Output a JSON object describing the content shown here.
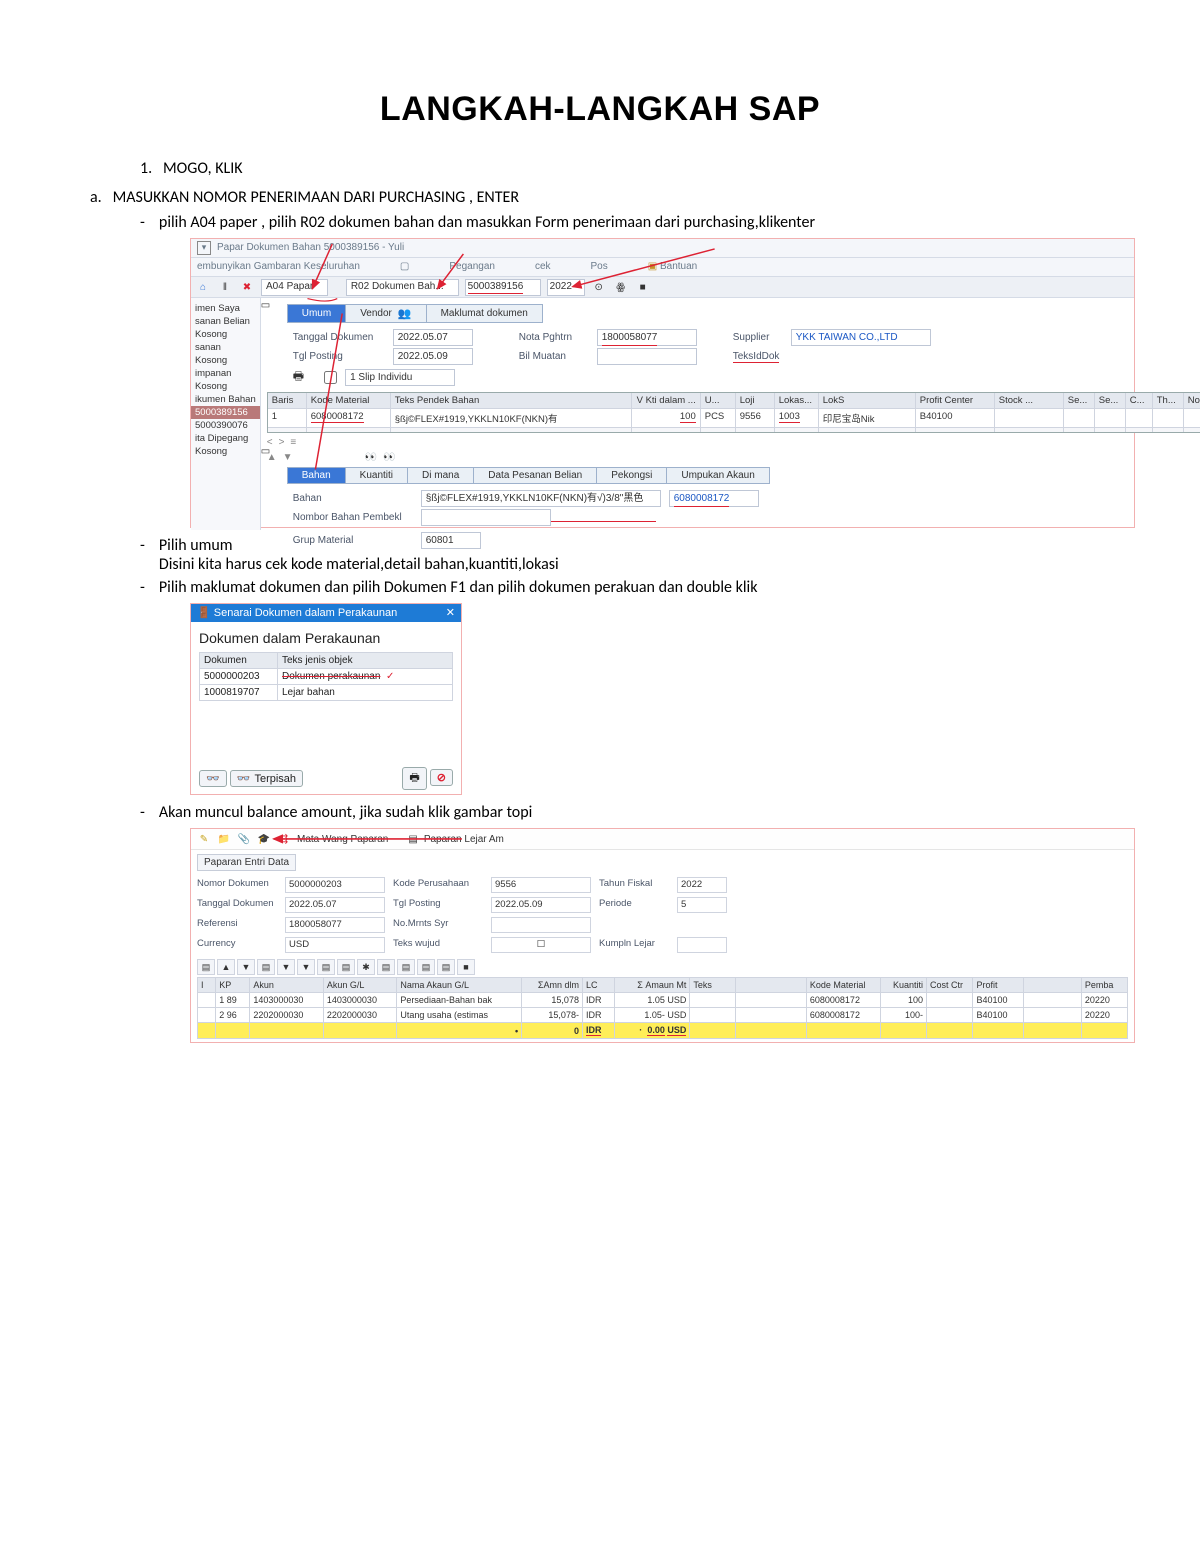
{
  "title": "LANGKAH-LANGKAH SAP",
  "step1": "MOGO, KLIK",
  "step_a": "MASUKKAN NOMOR PENERIMAAN DARI PURCHASING , ENTER",
  "bullet1": "pilih A04 paper , pilih R02 dokumen bahan  dan masukkan Form penerimaan dari purchasing,klikenter",
  "bullet2a": "Pilih umum",
  "bullet2b": "Disini kita harus cek kode material,detail bahan,kuantiti,lokasi",
  "bullet3": "Pilih maklumat dokumen dan pilih Dokumen F1 dan pilih dokumen perakuan dan double klik",
  "bullet4": "Akan muncul balance amount, jika sudah klik gambar topi",
  "sap1": {
    "title": "Papar Dokumen Bahan 5000389156 - Yuli",
    "subtitle": "embunyikan Gambaran Keseluruhan",
    "menu": {
      "pegangan": "Pegangan",
      "cek": "cek",
      "pos": "Pos",
      "bantuan": "Bantuan"
    },
    "a04": "A04 Papar",
    "r02": "R02 Dokumen Bah...",
    "doc": "5000389156",
    "year": "2022",
    "sidebar": {
      "i0": "imen Saya",
      "i1": "sanan Belian",
      "i2": "Kosong",
      "i3": "sanan",
      "i4": "Kosong",
      "i5": "impanan",
      "i6": "Kosong",
      "i7": "ikumen Bahan",
      "i8": "5000389156",
      "i9": "5000390076",
      "i10": "ita Dipegang",
      "i11": "Kosong"
    },
    "tabs": {
      "umum": "Umum",
      "vendor": "Vendor",
      "maklumat": "Maklumat dokumen"
    },
    "fields": {
      "tgl_dok_l": "Tanggal Dokumen",
      "tgl_dok_v": "2022.05.07",
      "tgl_post_l": "Tgl Posting",
      "tgl_post_v": "2022.05.09",
      "nota_l": "Nota Pghtrn",
      "nota_v": "1800058077",
      "bil_l": "Bil Muatan",
      "supp_l": "Supplier",
      "supp_v": "YKK TAIWAN CO.,LTD",
      "teks_l": "TeksIdDok",
      "slip": "1 Slip Individu"
    },
    "grid": {
      "h_baris": "Baris",
      "h_mat": "Kode Material",
      "h_desc": "Teks Pendek Bahan",
      "h_kti": "V Kti dalam ...",
      "h_u": "U...",
      "h_loji": "Loji",
      "h_lokas": "Lokas...",
      "h_loks": "LokS",
      "h_pc": "Profit Center",
      "h_stock": "Stock ...",
      "h_se": "Se...",
      "h_se2": "Se...",
      "h_c": "C...",
      "h_th": "Th...",
      "h_no": "No",
      "r1_baris": "1",
      "r1_mat": "6080008172",
      "r1_desc": "§ßj©FLEX#1919,YKKLN10KF(NKN)有",
      "r1_kti": "100",
      "r1_u": "PCS",
      "r1_loji": "9556",
      "r1_lokas": "1003",
      "r1_loks": "印尼宝岛Nik",
      "r1_pc": "B40100"
    },
    "tabs2": {
      "bahan": "Bahan",
      "kuantiti": "Kuantiti",
      "dimana": "Di mana",
      "data": "Data Pesanan Belian",
      "pekongsi": "Pekongsi",
      "umpukan": "Umpukan Akaun"
    },
    "detail": {
      "bahan_l": "Bahan",
      "bahan_v": "§ßj©FLEX#1919,YKKLN10KF(NKN)有√)3/8\"黑色0...",
      "bahan_c": "6080008172",
      "nbp_l": "Nombor Bahan Pembekl",
      "grup_l": "Grup Material",
      "grup_v": "60801"
    }
  },
  "sap2": {
    "title": "Senarai Dokumen dalam Perakaunan",
    "heading": "Dokumen dalam Perakaunan",
    "col1": "Dokumen",
    "col2": "Teks jenis objek",
    "r1a": "5000000203",
    "r1b": "Dokumen perakaunan",
    "r2a": "1000819707",
    "r2b": "Lejar bahan",
    "btn_terpisah": "Terpisah"
  },
  "sap3": {
    "btn1": "Mata Wang Paparan",
    "btn2": "Paparan Lejar Am",
    "crumb": "Paparan Entri Data",
    "h": {
      "nd_l": "Nomor Dokumen",
      "nd_v": "5000000203",
      "kp_l": "Kode Perusahaan",
      "kp_v": "9556",
      "tf_l": "Tahun Fiskal",
      "tf_v": "2022",
      "td_l": "Tanggal Dokumen",
      "td_v": "2022.05.07",
      "tp_l": "Tgl Posting",
      "tp_v": "2022.05.09",
      "pe_l": "Periode",
      "pe_v": "5",
      "rf_l": "Referensi",
      "rf_v": "1800058077",
      "nm_l": "No.Mrnts Syr",
      "cu_l": "Currency",
      "cu_v": "USD",
      "tw_l": "Teks wujud",
      "kl_l": "Kumpln Lejar"
    },
    "cols": {
      "i": "I",
      "kp": "KP",
      "akun": "Akun",
      "agl": "Akun G/L",
      "nama": "Nama Akaun G/L",
      "amn": "ΣAmn dlm",
      "lc": "LC",
      "amt": "Σ   Amaun Mt",
      "teks": "Teks",
      "km": "Kode Material",
      "kti": "Kuantiti",
      "cc": "Cost Ctr",
      "pc": "Profit",
      "pemba": "Pemba"
    },
    "r1": {
      "kp": "1 89",
      "akun": "1403000030",
      "agl": "1403000030",
      "nama": "Persediaan-Bahan bak",
      "amn": "15,078",
      "lc": "IDR",
      "amt": "1.05",
      "cur": "USD",
      "km": "6080008172",
      "kti": "100",
      "pc": "B40100",
      "pemba": "20220"
    },
    "r2": {
      "kp": "2 96",
      "akun": "2202000030",
      "agl": "2202000030",
      "nama": "Utang usaha (estimas",
      "amn": "15,078-",
      "lc": "IDR",
      "amt": "1.05-",
      "cur": "USD",
      "km": "6080008172",
      "kti": "100-",
      "pc": "B40100",
      "pemba": "20220"
    },
    "sum": {
      "amn": "0",
      "lc": "IDR",
      "dot": "·",
      "amt": "0.00",
      "cur": "USD"
    }
  }
}
